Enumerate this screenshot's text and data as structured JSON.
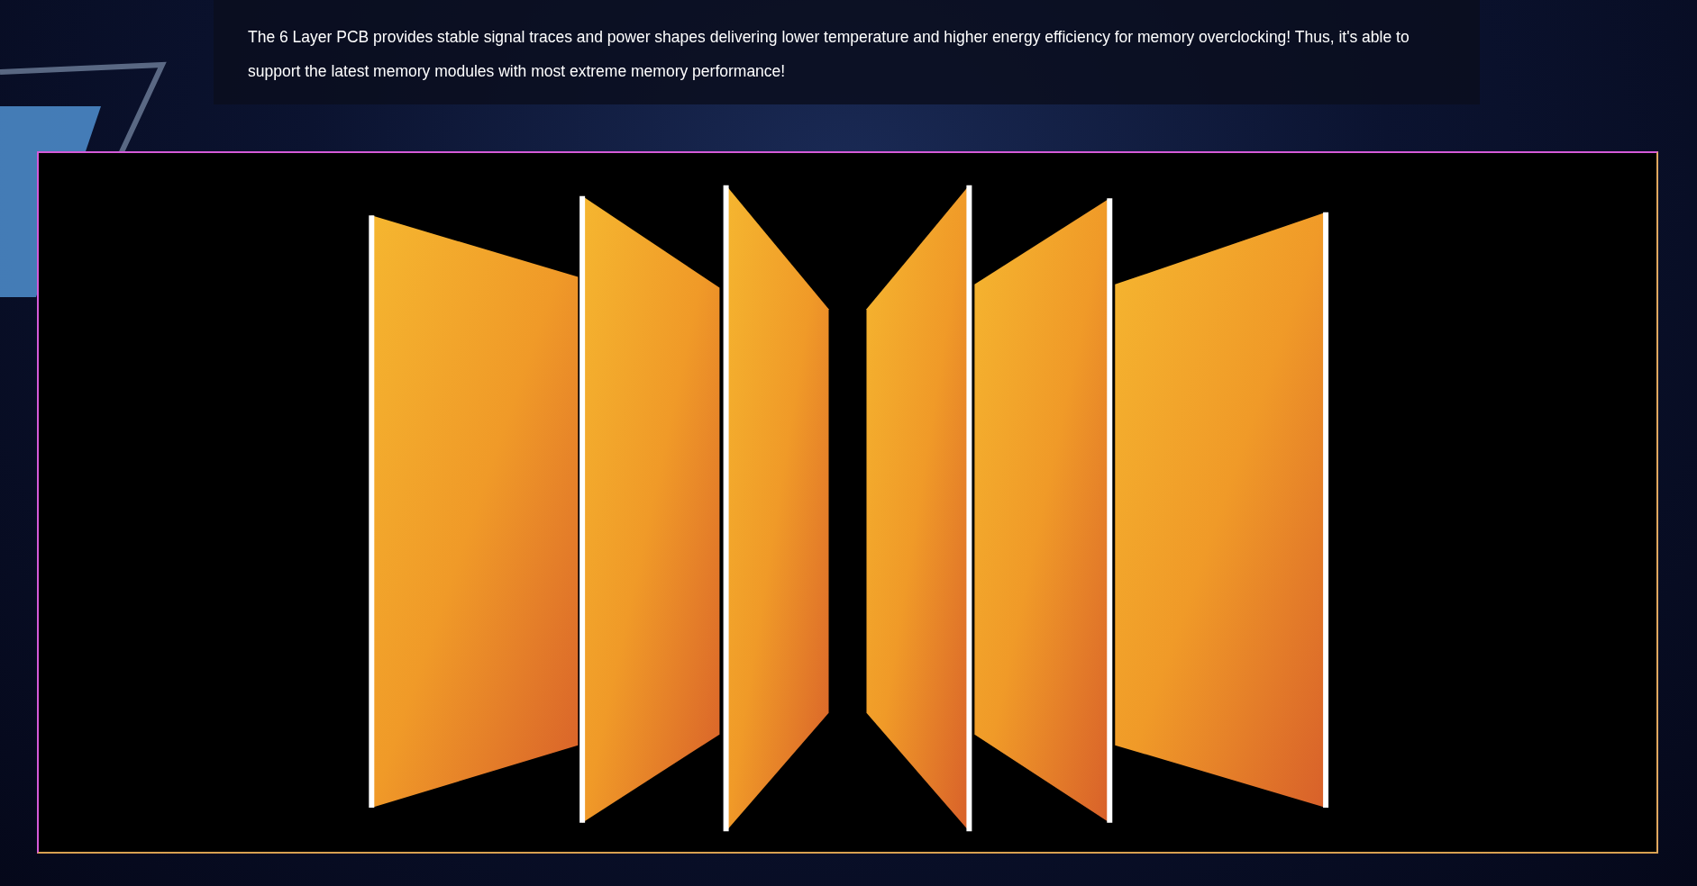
{
  "description": {
    "text": "The 6 Layer PCB provides stable signal traces and power shapes delivering lower temperature and higher energy efficiency for memory overclocking! Thus, it's able to support the latest memory modules with most extreme memory performance!"
  }
}
